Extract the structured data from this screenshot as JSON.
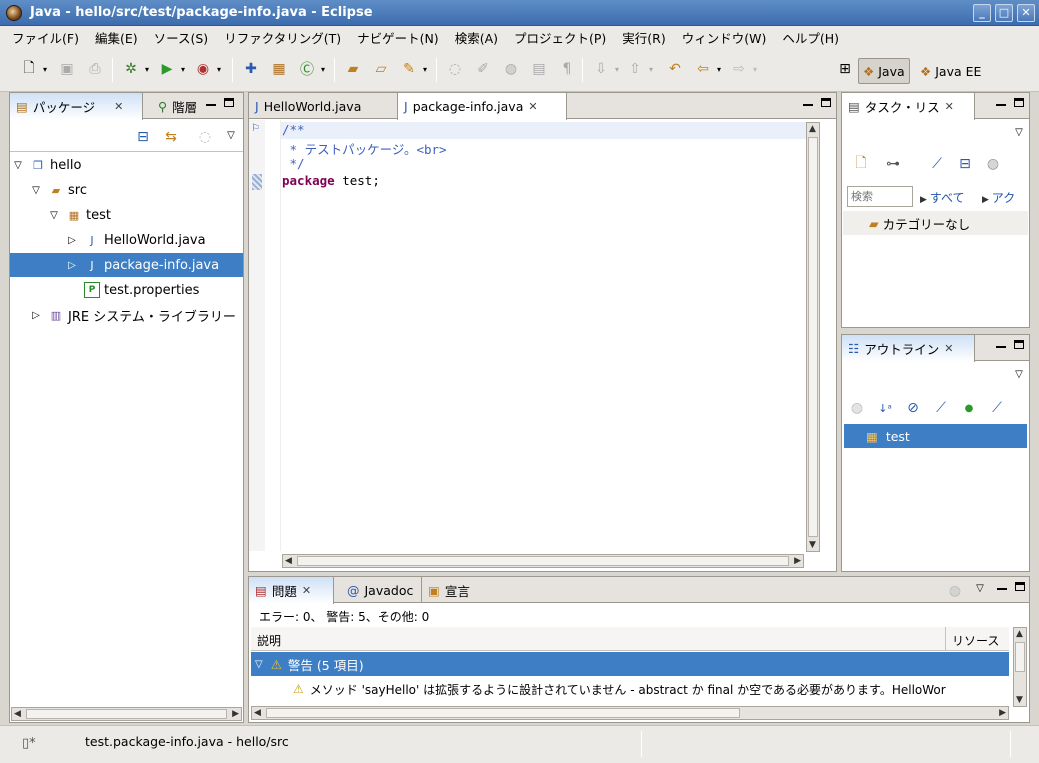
{
  "window": {
    "title": "Java - hello/src/test/package-info.java - Eclipse"
  },
  "menu": [
    "ファイル(F)",
    "編集(E)",
    "ソース(S)",
    "リファクタリング(T)",
    "ナビゲート(N)",
    "検索(A)",
    "プロジェクト(P)",
    "実行(R)",
    "ウィンドウ(W)",
    "ヘルプ(H)"
  ],
  "perspectives": {
    "java": "Java",
    "java_ee": "Java EE"
  },
  "package_explorer": {
    "tab_label": "パッケージ",
    "tab2_label": "階層",
    "tree": [
      {
        "label": "hello",
        "icon": "project-icon"
      },
      {
        "label": "src",
        "icon": "source-folder-icon"
      },
      {
        "label": "test",
        "icon": "package-icon"
      },
      {
        "label": "HelloWorld.java",
        "icon": "java-file-icon"
      },
      {
        "label": "package-info.java",
        "icon": "java-file-icon"
      },
      {
        "label": "test.properties",
        "icon": "properties-file-icon"
      },
      {
        "label": "JRE システム・ライブラリー",
        "icon": "library-icon"
      }
    ]
  },
  "editor": {
    "tabs": [
      "HelloWorld.java",
      "package-info.java"
    ],
    "lines": [
      {
        "text": "/**",
        "type": "comment"
      },
      {
        "text": " * テストパッケージ。<br>",
        "type": "comment"
      },
      {
        "text": " */",
        "type": "comment"
      },
      {
        "kw": "package",
        "rest": " test;"
      }
    ]
  },
  "tasks": {
    "tab_label": "タスク・リス",
    "search_placeholder": "検索",
    "filter_all": "すべて",
    "filter_act": "アク",
    "category": "カテゴリーなし"
  },
  "outline": {
    "tab_label": "アウトライン",
    "items": [
      "test"
    ]
  },
  "problems": {
    "tabs": [
      "問題",
      "Javadoc",
      "宣言"
    ],
    "summary": "エラー: 0、 警告: 5、その他: 0",
    "col_description": "説明",
    "col_resource": "リソース",
    "group": "警告 (5 項目)",
    "message": "メソッド 'sayHello' は拡張するように設計されていません - abstract か final か空である必要があります。HelloWor"
  },
  "status": {
    "text": "test.package-info.java - hello/src"
  },
  "colors": {
    "selection": "#3d7ec5",
    "comment": "#3f5fbf",
    "keyword": "#7f0055"
  }
}
